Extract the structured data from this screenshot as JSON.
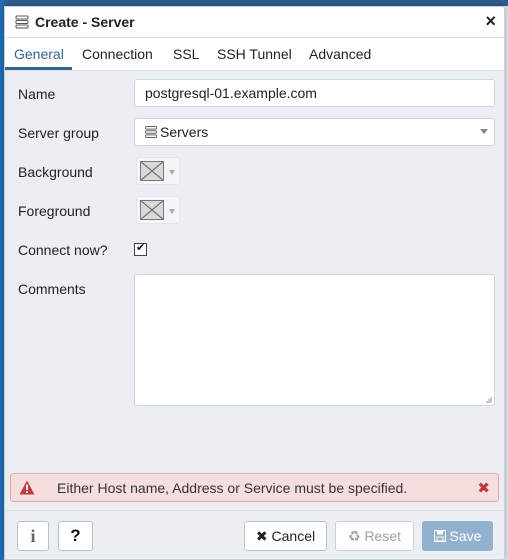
{
  "dialog": {
    "title": "Create - Server",
    "close_label": "×"
  },
  "tabs": [
    {
      "label": "General",
      "active": true
    },
    {
      "label": "Connection"
    },
    {
      "label": "SSL"
    },
    {
      "label": "SSH Tunnel"
    },
    {
      "label": "Advanced"
    }
  ],
  "form": {
    "name_label": "Name",
    "name_value": "postgresql-01.example.com",
    "server_group_label": "Server group",
    "server_group_value": "Servers",
    "background_label": "Background",
    "foreground_label": "Foreground",
    "connect_now_label": "Connect now?",
    "connect_now_checked": true,
    "checkmark": "✔",
    "comments_label": "Comments",
    "comments_value": ""
  },
  "alert": {
    "message": "Either Host name, Address or Service must be specified.",
    "close_label": "✖",
    "color": "#c0393b"
  },
  "footer": {
    "info_label": "i",
    "help_label": "?",
    "cancel_label": "Cancel",
    "reset_label": "Reset",
    "save_label": "Save"
  },
  "colors": {
    "accent": "#326690",
    "save_disabled": "#91b2cf"
  },
  "icons": [
    "server-group-icon",
    "close-icon",
    "servers-icon",
    "warning-icon",
    "info-icon",
    "help-icon",
    "times-icon",
    "recycle-icon",
    "floppy-icon",
    "resize-grip-icon"
  ]
}
